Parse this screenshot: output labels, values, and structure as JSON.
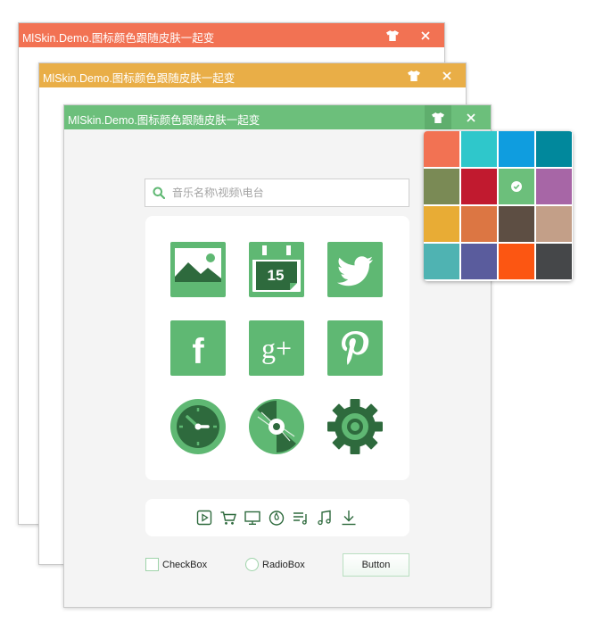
{
  "windows": [
    {
      "title": "MlSkin.Demo.图标颜色跟随皮肤一起变",
      "theme_color": "#f27253"
    },
    {
      "title": "MlSkin.Demo.图标颜色跟随皮肤一起变",
      "theme_color": "#e9ae47"
    },
    {
      "title": "MlSkin.Demo.图标颜色跟随皮肤一起变",
      "theme_color": "#6cbf7b"
    }
  ],
  "search": {
    "placeholder": "音乐名称\\视频\\电台",
    "value": ""
  },
  "icon_grid": {
    "color": "#5fb873",
    "dark_color": "#2e6a3d",
    "items": [
      {
        "name": "image-icon"
      },
      {
        "name": "calendar-icon",
        "label": "15"
      },
      {
        "name": "twitter-icon"
      },
      {
        "name": "facebook-icon",
        "label": "f"
      },
      {
        "name": "google-plus-icon",
        "label": "g+"
      },
      {
        "name": "pinterest-icon"
      },
      {
        "name": "clock-icon"
      },
      {
        "name": "disc-icon"
      },
      {
        "name": "gear-icon"
      }
    ]
  },
  "toolbar": {
    "icons": [
      "play-icon",
      "cart-icon",
      "monitor-icon",
      "flame-icon",
      "playlist-icon",
      "music-note-icon",
      "download-icon"
    ]
  },
  "controls": {
    "checkbox_label": "CheckBox",
    "radio_label": "RadioBox",
    "button_label": "Button"
  },
  "skin_palette": {
    "selected": "#6cbf7b",
    "colors": [
      "#f27253",
      "#2fc7cb",
      "#0f9ddf",
      "#01889c",
      "#7a8a55",
      "#c11a2f",
      "#6cbf7b",
      "#a766a6",
      "#e8ac35",
      "#dc7643",
      "#5d4e43",
      "#c39f88",
      "#4fb3b2",
      "#5a5c9d",
      "#fc5612",
      "#454749"
    ]
  }
}
